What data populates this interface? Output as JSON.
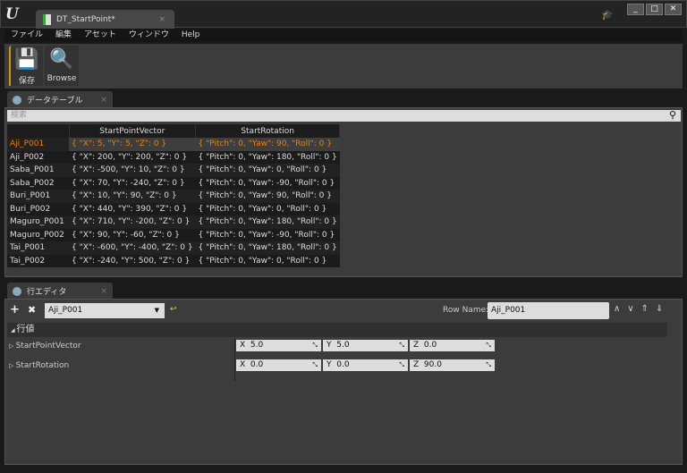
{
  "window": {
    "tab_title": "DT_StartPoint*",
    "logo": "U"
  },
  "menu": [
    "ファイル",
    "編集",
    "アセット",
    "ウィンドウ",
    "Help"
  ],
  "toolbar": {
    "save": "保存",
    "browse": "Browse"
  },
  "data_table": {
    "tab": "データテーブル",
    "search_placeholder": "検索",
    "columns": [
      "",
      "StartPointVector",
      "StartRotation"
    ],
    "rows": [
      [
        "Aji_P001",
        "{ \"X\": 5, \"Y\": 5, \"Z\": 0 }",
        "{ \"Pitch\": 0, \"Yaw\": 90, \"Roll\": 0 }"
      ],
      [
        "Aji_P002",
        "{ \"X\": 200, \"Y\": 200, \"Z\": 0 }",
        "{ \"Pitch\": 0, \"Yaw\": 180, \"Roll\": 0 }"
      ],
      [
        "Saba_P001",
        "{ \"X\": -500, \"Y\": 10, \"Z\": 0 }",
        "{ \"Pitch\": 0, \"Yaw\": 0, \"Roll\": 0 }"
      ],
      [
        "Saba_P002",
        "{ \"X\": 70, \"Y\": -240, \"Z\": 0 }",
        "{ \"Pitch\": 0, \"Yaw\": -90, \"Roll\": 0 }"
      ],
      [
        "Buri_P001",
        "{ \"X\": 10, \"Y\": 90, \"Z\": 0 }",
        "{ \"Pitch\": 0, \"Yaw\": 90, \"Roll\": 0 }"
      ],
      [
        "Buri_P002",
        "{ \"X\": 440, \"Y\": 390, \"Z\": 0 }",
        "{ \"Pitch\": 0, \"Yaw\": 0, \"Roll\": 0 }"
      ],
      [
        "Maguro_P001",
        "{ \"X\": 710, \"Y\": -200, \"Z\": 0 }",
        "{ \"Pitch\": 0, \"Yaw\": 180, \"Roll\": 0 }"
      ],
      [
        "Maguro_P002",
        "{ \"X\": 90, \"Y\": -60, \"Z\": 0 }",
        "{ \"Pitch\": 0, \"Yaw\": -90, \"Roll\": 0 }"
      ],
      [
        "Tai_P001",
        "{ \"X\": -600, \"Y\": -400, \"Z\": 0 }",
        "{ \"Pitch\": 0, \"Yaw\": 180, \"Roll\": 0 }"
      ],
      [
        "Tai_P002",
        "{ \"X\": -240, \"Y\": 500, \"Z\": 0 }",
        "{ \"Pitch\": 0, \"Yaw\": 0, \"Roll\": 0 }"
      ]
    ],
    "selected_index": 0,
    "selected_color": "#e8820c"
  },
  "row_editor": {
    "tab": "行エディタ",
    "selected_row": "Aji_P001",
    "row_name_label": "Row Name:",
    "row_name": "Aji_P001",
    "section": "行値",
    "props": [
      {
        "name": "StartPointVector",
        "fields": [
          [
            "X",
            "5.0"
          ],
          [
            "Y",
            "5.0"
          ],
          [
            "Z",
            "0.0"
          ]
        ]
      },
      {
        "name": "StartRotation",
        "fields": [
          [
            "X",
            "0.0"
          ],
          [
            "Y",
            "0.0"
          ],
          [
            "Z",
            "90.0"
          ]
        ]
      }
    ]
  }
}
